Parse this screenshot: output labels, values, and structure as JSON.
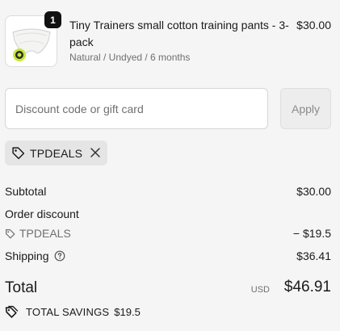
{
  "line_item": {
    "quantity": "1",
    "title": "Tiny Trainers small cotton training pants - 3-pack",
    "variant": "Natural / Undyed / 6 months",
    "price": "$30.00"
  },
  "discount": {
    "placeholder": "Discount code or gift card",
    "apply_label": "Apply",
    "applied_code": "TPDEALS"
  },
  "summary": {
    "subtotal_label": "Subtotal",
    "subtotal_value": "$30.00",
    "order_discount_label": "Order discount",
    "discount_code": "TPDEALS",
    "discount_value": "− $19.5",
    "shipping_label": "Shipping",
    "shipping_value": "$36.41",
    "total_label": "Total",
    "total_currency": "USD",
    "total_value": "$46.91",
    "savings_label": "TOTAL SAVINGS",
    "savings_value": "$19.5"
  },
  "icons": {
    "tag": "tag-icon",
    "remove": "close-icon",
    "help": "help-circle-icon",
    "savings": "savings-tag-icon"
  },
  "colors": {
    "background": "#f5f5f5",
    "text": "#1a1a1a",
    "muted": "#707070",
    "chip": "#e5e5e5",
    "badge": "#111111"
  }
}
